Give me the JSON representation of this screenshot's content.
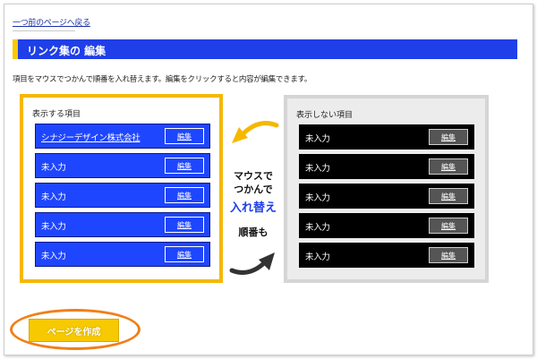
{
  "nav": {
    "back_link": "一つ前のページへ戻る"
  },
  "header": {
    "title": "リンク集の 編集"
  },
  "instructions": "項目をマウスでつかんで順番を入れ替えます。編集をクリックすると内容が編集できます。",
  "shown_panel": {
    "label": "表示する項目",
    "items": [
      {
        "text": "シナジーデザイン株式会社",
        "edit_label": "編集"
      },
      {
        "text": "未入力",
        "edit_label": "編集"
      },
      {
        "text": "未入力",
        "edit_label": "編集"
      },
      {
        "text": "未入力",
        "edit_label": "編集"
      },
      {
        "text": "未入力",
        "edit_label": "編集"
      }
    ]
  },
  "hidden_panel": {
    "label": "表示しない項目",
    "items": [
      {
        "text": "未入力",
        "edit_label": "編集"
      },
      {
        "text": "未入力",
        "edit_label": "編集"
      },
      {
        "text": "未入力",
        "edit_label": "編集"
      },
      {
        "text": "未入力",
        "edit_label": "編集"
      },
      {
        "text": "未入力",
        "edit_label": "編集"
      }
    ]
  },
  "hint": {
    "line1": "マウスで",
    "line2": "つかんで",
    "line3": "入れ替え",
    "line4": "順番も"
  },
  "actions": {
    "create_page": "ページを作成"
  },
  "colors": {
    "accent_blue": "#1f3fe8",
    "accent_yellow": "#f7c900",
    "highlight_orange": "#f07f18",
    "hidden_row": "#000000"
  },
  "icons": {
    "top_arrow": "curved-arrow-left-icon",
    "bottom_arrow": "curved-arrow-right-icon"
  }
}
